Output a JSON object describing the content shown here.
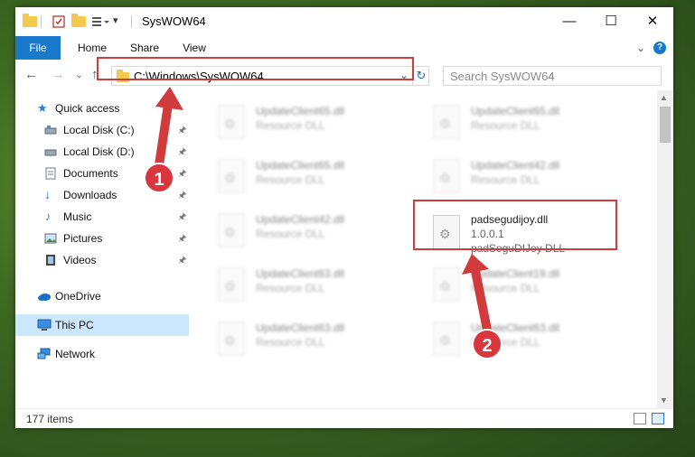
{
  "window": {
    "title": "SysWOW64",
    "controls": {
      "minimize": "—",
      "maximize": "☐",
      "close": "✕"
    }
  },
  "ribbon": {
    "tabs": [
      "File",
      "Home",
      "Share",
      "View"
    ],
    "expand_glyph": "⌄",
    "help_glyph": "?"
  },
  "nav": {
    "back": "←",
    "forward": "→",
    "recent": "⌄",
    "up": "↑",
    "address": "C:\\Windows\\SysWOW64",
    "address_dropdown": "⌄",
    "refresh": "↻",
    "search_placeholder": "Search SysWOW64"
  },
  "sidebar": {
    "items": [
      {
        "label": "Quick access",
        "icon": "star-icon",
        "pinned": false
      },
      {
        "label": "Local Disk (C:)",
        "icon": "drive-icon",
        "pinned": true
      },
      {
        "label": "Local Disk (D:)",
        "icon": "drive-icon",
        "pinned": true
      },
      {
        "label": "Documents",
        "icon": "documents-icon",
        "pinned": true
      },
      {
        "label": "Downloads",
        "icon": "download-icon",
        "pinned": true
      },
      {
        "label": "Music",
        "icon": "music-icon",
        "pinned": true
      },
      {
        "label": "Pictures",
        "icon": "pictures-icon",
        "pinned": true
      },
      {
        "label": "Videos",
        "icon": "videos-icon",
        "pinned": true
      },
      {
        "label": "OneDrive",
        "icon": "cloud-icon",
        "pinned": false
      },
      {
        "label": "This PC",
        "icon": "computer-icon",
        "pinned": false,
        "selected": true
      },
      {
        "label": "Network",
        "icon": "network-icon",
        "pinned": false
      }
    ],
    "pin_glyph": "📌"
  },
  "files": {
    "left_column": [
      {
        "name": "UpdateClient65.dll",
        "type": "Resource DLL"
      },
      {
        "name": "UpdateClient65.dll",
        "type": "Resource DLL"
      },
      {
        "name": "UpdateClient42.dll",
        "type": "Resource DLL"
      },
      {
        "name": "UpdateClient63.dll",
        "type": "Resource DLL"
      },
      {
        "name": "UpdateClient63.dll",
        "type": "Resource DLL"
      }
    ],
    "right_column": [
      {
        "name": "UpdateClient65.dll",
        "type": "Resource DLL"
      },
      {
        "name": "UpdateClient42.dll",
        "type": "Resource DLL"
      },
      {
        "name": "UpdateClient19.dll",
        "type": "Resource DLL"
      },
      {
        "name": "UpdateClient63.dll",
        "type": "Resource DLL"
      }
    ],
    "highlighted": {
      "name": "padsegudijoy.dll",
      "version": "1.0.0.1",
      "description": "padSeguDIJoy DLL"
    }
  },
  "status": {
    "item_count": "177 items"
  },
  "annotations": {
    "step1": "1",
    "step2": "2",
    "color": "#d23b3b"
  }
}
